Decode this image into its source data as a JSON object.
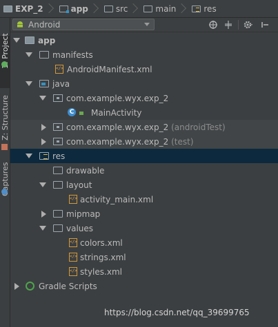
{
  "breadcrumb": [
    {
      "label": "EXP_2",
      "icon": "project-folder-icon",
      "bold": true
    },
    {
      "label": "app",
      "icon": "module-folder-icon",
      "bold": true
    },
    {
      "label": "src",
      "icon": "folder-icon",
      "bold": false
    },
    {
      "label": "main",
      "icon": "folder-icon",
      "bold": false
    },
    {
      "label": "res",
      "icon": "res-folder-icon",
      "bold": false
    }
  ],
  "side_tabs": {
    "project": "1: Project",
    "structure": "Z: Structure",
    "captures": "Captures"
  },
  "view_selector": {
    "selected": "Android"
  },
  "tree": [
    {
      "label": "app",
      "icon": "module-folder-icon",
      "expanded": true,
      "level": 0,
      "bold": true
    },
    {
      "label": "manifests",
      "icon": "folder-icon",
      "expanded": true,
      "level": 1
    },
    {
      "label": "AndroidManifest.xml",
      "icon": "xml-file-icon",
      "level": 2
    },
    {
      "label": "java",
      "icon": "java-folder-icon",
      "expanded": true,
      "level": 1
    },
    {
      "label": "com.example.wyx.exp_2",
      "icon": "package-icon",
      "expanded": true,
      "level": 2
    },
    {
      "label": "MainActivity",
      "icon": "class-icon",
      "level": 3
    },
    {
      "label": "com.example.wyx.exp_2",
      "suffix": "(androidTest)",
      "icon": "package-icon",
      "expanded": false,
      "level": 2
    },
    {
      "label": "com.example.wyx.exp_2",
      "suffix": "(test)",
      "icon": "package-icon",
      "expanded": false,
      "level": 2
    },
    {
      "label": "res",
      "icon": "res-folder-icon",
      "expanded": true,
      "level": 1,
      "selected": true
    },
    {
      "label": "drawable",
      "icon": "folder-icon",
      "level": 2
    },
    {
      "label": "layout",
      "icon": "folder-icon",
      "expanded": true,
      "level": 2
    },
    {
      "label": "activity_main.xml",
      "icon": "xml-file-icon",
      "level": 3
    },
    {
      "label": "mipmap",
      "icon": "folder-icon",
      "expanded": false,
      "level": 2
    },
    {
      "label": "values",
      "icon": "folder-icon",
      "expanded": true,
      "level": 2
    },
    {
      "label": "colors.xml",
      "icon": "xml-file-icon",
      "level": 3
    },
    {
      "label": "strings.xml",
      "icon": "xml-file-icon",
      "level": 3
    },
    {
      "label": "styles.xml",
      "icon": "xml-file-icon",
      "level": 3
    },
    {
      "label": "Gradle Scripts",
      "icon": "gradle-icon",
      "expanded": false,
      "level": 0
    }
  ],
  "watermark": "https://blog.csdn.net/qq_39699765",
  "colors": {
    "background": "#3c3f41",
    "selection": "#0d293e",
    "text": "#bbbbbb",
    "class_icon": "#3d8ccd",
    "xml_icon": "#e8a33d"
  }
}
